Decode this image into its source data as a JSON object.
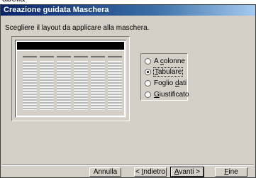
{
  "caption_text": "abella",
  "window": {
    "title": "Creazione guidata Maschera",
    "instruction": "Scegliere il layout da applicare alla maschera."
  },
  "layout_options": {
    "selected": "Tabulare",
    "items": [
      {
        "pre": "A ",
        "key": "c",
        "post": "olonne",
        "checked": false
      },
      {
        "pre": "",
        "key": "T",
        "post": "abulare",
        "checked": true
      },
      {
        "pre": "Foglio ",
        "key": "d",
        "post": "ati",
        "checked": false
      },
      {
        "pre": "",
        "key": "G",
        "post": "iustificato",
        "checked": false
      }
    ]
  },
  "buttons": {
    "cancel": "Annulla",
    "back": {
      "pre": "< ",
      "key": "I",
      "post": "ndietro"
    },
    "next": {
      "pre": "",
      "key": "A",
      "post": "vanti >"
    },
    "finish": {
      "pre": "",
      "key": "F",
      "post": "ine"
    }
  },
  "colors": {
    "titlebar_start": "#0a246a",
    "titlebar_end": "#a6caf0",
    "face": "#d4d0c8"
  }
}
